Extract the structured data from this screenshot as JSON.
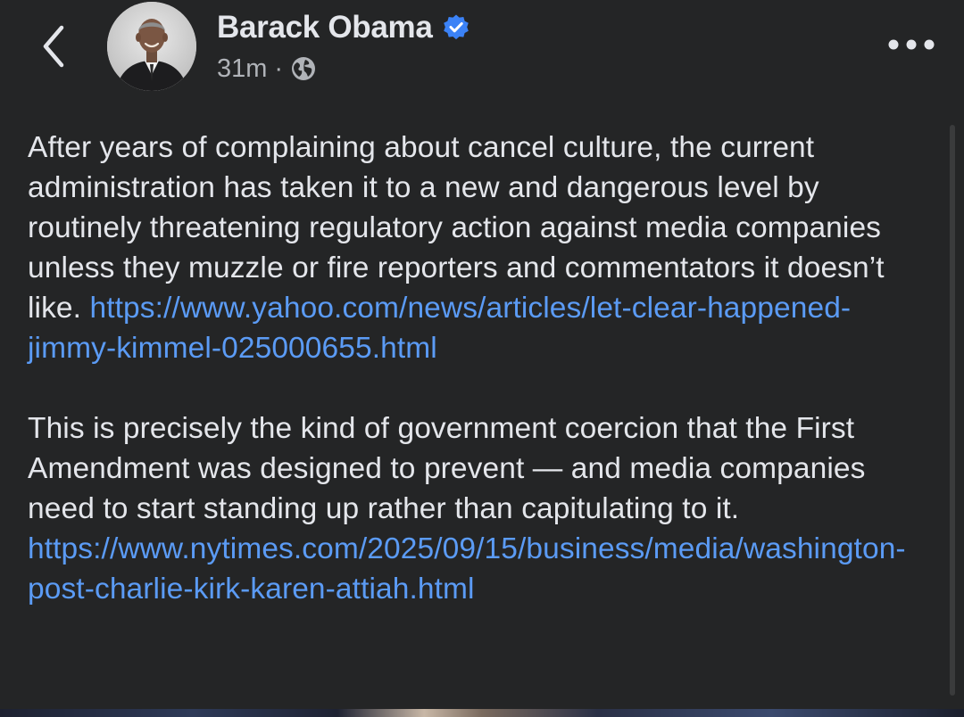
{
  "header": {
    "back_icon": "chevron-left-icon",
    "author_name": "Barack Obama",
    "verified_icon": "verified-badge-icon",
    "timestamp": "31m",
    "separator": "·",
    "audience_icon": "globe-icon",
    "more_icon": "more-options-icon"
  },
  "post": {
    "para1_text": "After years of complaining about cancel culture, the current administration has taken it to a new and dangerous level by routinely threatening regulatory action against media companies unless they muzzle or fire reporters and commentators it doesn’t like. ",
    "para1_link": "https://www.yahoo.com/news/articles/let-clear-happened-jimmy-kimmel-025000655.html",
    "para2_text": "This is precisely the kind of government coercion that the First Amendment was designed to prevent — and media companies need to start standing up rather than capitulating to it.",
    "para2_link": "https://www.nytimes.com/2025/09/15/business/media/washington-post-charlie-kirk-karen-attiah.html"
  },
  "colors": {
    "background": "#242526",
    "text": "#e4e6eb",
    "secondary_text": "#b0b3b8",
    "link": "#5b9bf5",
    "verified": "#3b82f6"
  }
}
